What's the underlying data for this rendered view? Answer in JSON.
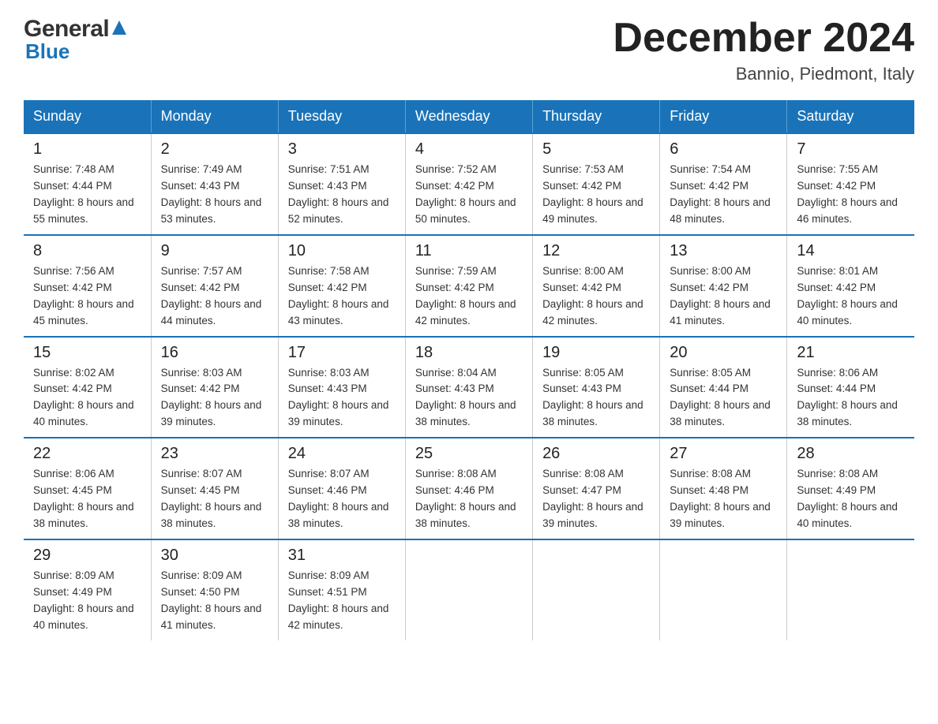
{
  "logo": {
    "general": "General",
    "blue": "Blue"
  },
  "title": {
    "month": "December 2024",
    "location": "Bannio, Piedmont, Italy"
  },
  "days_header": [
    "Sunday",
    "Monday",
    "Tuesday",
    "Wednesday",
    "Thursday",
    "Friday",
    "Saturday"
  ],
  "weeks": [
    [
      {
        "num": "1",
        "sunrise": "7:48 AM",
        "sunset": "4:44 PM",
        "daylight": "8 hours and 55 minutes."
      },
      {
        "num": "2",
        "sunrise": "7:49 AM",
        "sunset": "4:43 PM",
        "daylight": "8 hours and 53 minutes."
      },
      {
        "num": "3",
        "sunrise": "7:51 AM",
        "sunset": "4:43 PM",
        "daylight": "8 hours and 52 minutes."
      },
      {
        "num": "4",
        "sunrise": "7:52 AM",
        "sunset": "4:42 PM",
        "daylight": "8 hours and 50 minutes."
      },
      {
        "num": "5",
        "sunrise": "7:53 AM",
        "sunset": "4:42 PM",
        "daylight": "8 hours and 49 minutes."
      },
      {
        "num": "6",
        "sunrise": "7:54 AM",
        "sunset": "4:42 PM",
        "daylight": "8 hours and 48 minutes."
      },
      {
        "num": "7",
        "sunrise": "7:55 AM",
        "sunset": "4:42 PM",
        "daylight": "8 hours and 46 minutes."
      }
    ],
    [
      {
        "num": "8",
        "sunrise": "7:56 AM",
        "sunset": "4:42 PM",
        "daylight": "8 hours and 45 minutes."
      },
      {
        "num": "9",
        "sunrise": "7:57 AM",
        "sunset": "4:42 PM",
        "daylight": "8 hours and 44 minutes."
      },
      {
        "num": "10",
        "sunrise": "7:58 AM",
        "sunset": "4:42 PM",
        "daylight": "8 hours and 43 minutes."
      },
      {
        "num": "11",
        "sunrise": "7:59 AM",
        "sunset": "4:42 PM",
        "daylight": "8 hours and 42 minutes."
      },
      {
        "num": "12",
        "sunrise": "8:00 AM",
        "sunset": "4:42 PM",
        "daylight": "8 hours and 42 minutes."
      },
      {
        "num": "13",
        "sunrise": "8:00 AM",
        "sunset": "4:42 PM",
        "daylight": "8 hours and 41 minutes."
      },
      {
        "num": "14",
        "sunrise": "8:01 AM",
        "sunset": "4:42 PM",
        "daylight": "8 hours and 40 minutes."
      }
    ],
    [
      {
        "num": "15",
        "sunrise": "8:02 AM",
        "sunset": "4:42 PM",
        "daylight": "8 hours and 40 minutes."
      },
      {
        "num": "16",
        "sunrise": "8:03 AM",
        "sunset": "4:42 PM",
        "daylight": "8 hours and 39 minutes."
      },
      {
        "num": "17",
        "sunrise": "8:03 AM",
        "sunset": "4:43 PM",
        "daylight": "8 hours and 39 minutes."
      },
      {
        "num": "18",
        "sunrise": "8:04 AM",
        "sunset": "4:43 PM",
        "daylight": "8 hours and 38 minutes."
      },
      {
        "num": "19",
        "sunrise": "8:05 AM",
        "sunset": "4:43 PM",
        "daylight": "8 hours and 38 minutes."
      },
      {
        "num": "20",
        "sunrise": "8:05 AM",
        "sunset": "4:44 PM",
        "daylight": "8 hours and 38 minutes."
      },
      {
        "num": "21",
        "sunrise": "8:06 AM",
        "sunset": "4:44 PM",
        "daylight": "8 hours and 38 minutes."
      }
    ],
    [
      {
        "num": "22",
        "sunrise": "8:06 AM",
        "sunset": "4:45 PM",
        "daylight": "8 hours and 38 minutes."
      },
      {
        "num": "23",
        "sunrise": "8:07 AM",
        "sunset": "4:45 PM",
        "daylight": "8 hours and 38 minutes."
      },
      {
        "num": "24",
        "sunrise": "8:07 AM",
        "sunset": "4:46 PM",
        "daylight": "8 hours and 38 minutes."
      },
      {
        "num": "25",
        "sunrise": "8:08 AM",
        "sunset": "4:46 PM",
        "daylight": "8 hours and 38 minutes."
      },
      {
        "num": "26",
        "sunrise": "8:08 AM",
        "sunset": "4:47 PM",
        "daylight": "8 hours and 39 minutes."
      },
      {
        "num": "27",
        "sunrise": "8:08 AM",
        "sunset": "4:48 PM",
        "daylight": "8 hours and 39 minutes."
      },
      {
        "num": "28",
        "sunrise": "8:08 AM",
        "sunset": "4:49 PM",
        "daylight": "8 hours and 40 minutes."
      }
    ],
    [
      {
        "num": "29",
        "sunrise": "8:09 AM",
        "sunset": "4:49 PM",
        "daylight": "8 hours and 40 minutes."
      },
      {
        "num": "30",
        "sunrise": "8:09 AM",
        "sunset": "4:50 PM",
        "daylight": "8 hours and 41 minutes."
      },
      {
        "num": "31",
        "sunrise": "8:09 AM",
        "sunset": "4:51 PM",
        "daylight": "8 hours and 42 minutes."
      },
      null,
      null,
      null,
      null
    ]
  ]
}
